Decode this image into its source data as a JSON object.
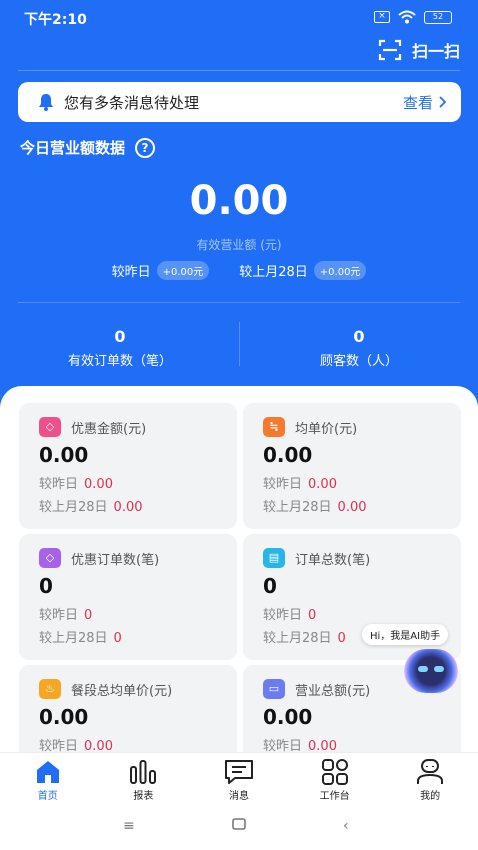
{
  "status": {
    "time": "下午2:10",
    "battery": "52"
  },
  "header": {
    "scan_label": "扫一扫"
  },
  "notice": {
    "text": "您有多条消息待处理",
    "action": "查看"
  },
  "revenue": {
    "title": "今日营业额数据",
    "value": "0.00",
    "label": "有效营业额 (元)",
    "cmp_yesterday_label": "较昨日",
    "cmp_yesterday_value": "+0.00元",
    "cmp_lastmonth_label": "较上月28日",
    "cmp_lastmonth_value": "+0.00元"
  },
  "stats": [
    {
      "value": "0",
      "label": "有效订单数（笔）"
    },
    {
      "value": "0",
      "label": "顾客数（人）"
    }
  ],
  "cards": [
    {
      "title": "优惠金额(元)",
      "value": "0.00",
      "y_label": "较昨日",
      "y_value": "0.00",
      "m_label": "较上月28日",
      "m_value": "0.00",
      "color": "#f0508a"
    },
    {
      "title": "均单价(元)",
      "value": "0.00",
      "y_label": "较昨日",
      "y_value": "0.00",
      "m_label": "较上月28日",
      "m_value": "0.00",
      "color": "#f57a2e"
    },
    {
      "title": "优惠订单数(笔)",
      "value": "0",
      "y_label": "较昨日",
      "y_value": "0",
      "m_label": "较上月28日",
      "m_value": "0",
      "color": "#a763e8"
    },
    {
      "title": "订单总数(笔)",
      "value": "0",
      "y_label": "较昨日",
      "y_value": "0",
      "m_label": "较上月28日",
      "m_value": "0",
      "color": "#28b6e8"
    },
    {
      "title": "餐段总均单价(元)",
      "value": "0.00",
      "y_label": "较昨日",
      "y_value": "0.00",
      "m_label": "",
      "m_value": "",
      "color": "#f5a623"
    },
    {
      "title": "营业总额(元)",
      "value": "0.00",
      "y_label": "较昨日",
      "y_value": "0.00",
      "m_label": "",
      "m_value": "",
      "color": "#6a7cf0"
    }
  ],
  "ai": {
    "bubble": "Hi，我是AI助手"
  },
  "tabs": [
    {
      "label": "首页",
      "icon": "home-icon",
      "active": true
    },
    {
      "label": "报表",
      "icon": "chart-icon",
      "active": false
    },
    {
      "label": "消息",
      "icon": "message-icon",
      "active": false
    },
    {
      "label": "工作台",
      "icon": "workbench-icon",
      "active": false
    },
    {
      "label": "我的",
      "icon": "profile-icon",
      "active": false
    }
  ],
  "colors": {
    "primary": "#1f6ef5",
    "negative": "#e0304e"
  }
}
